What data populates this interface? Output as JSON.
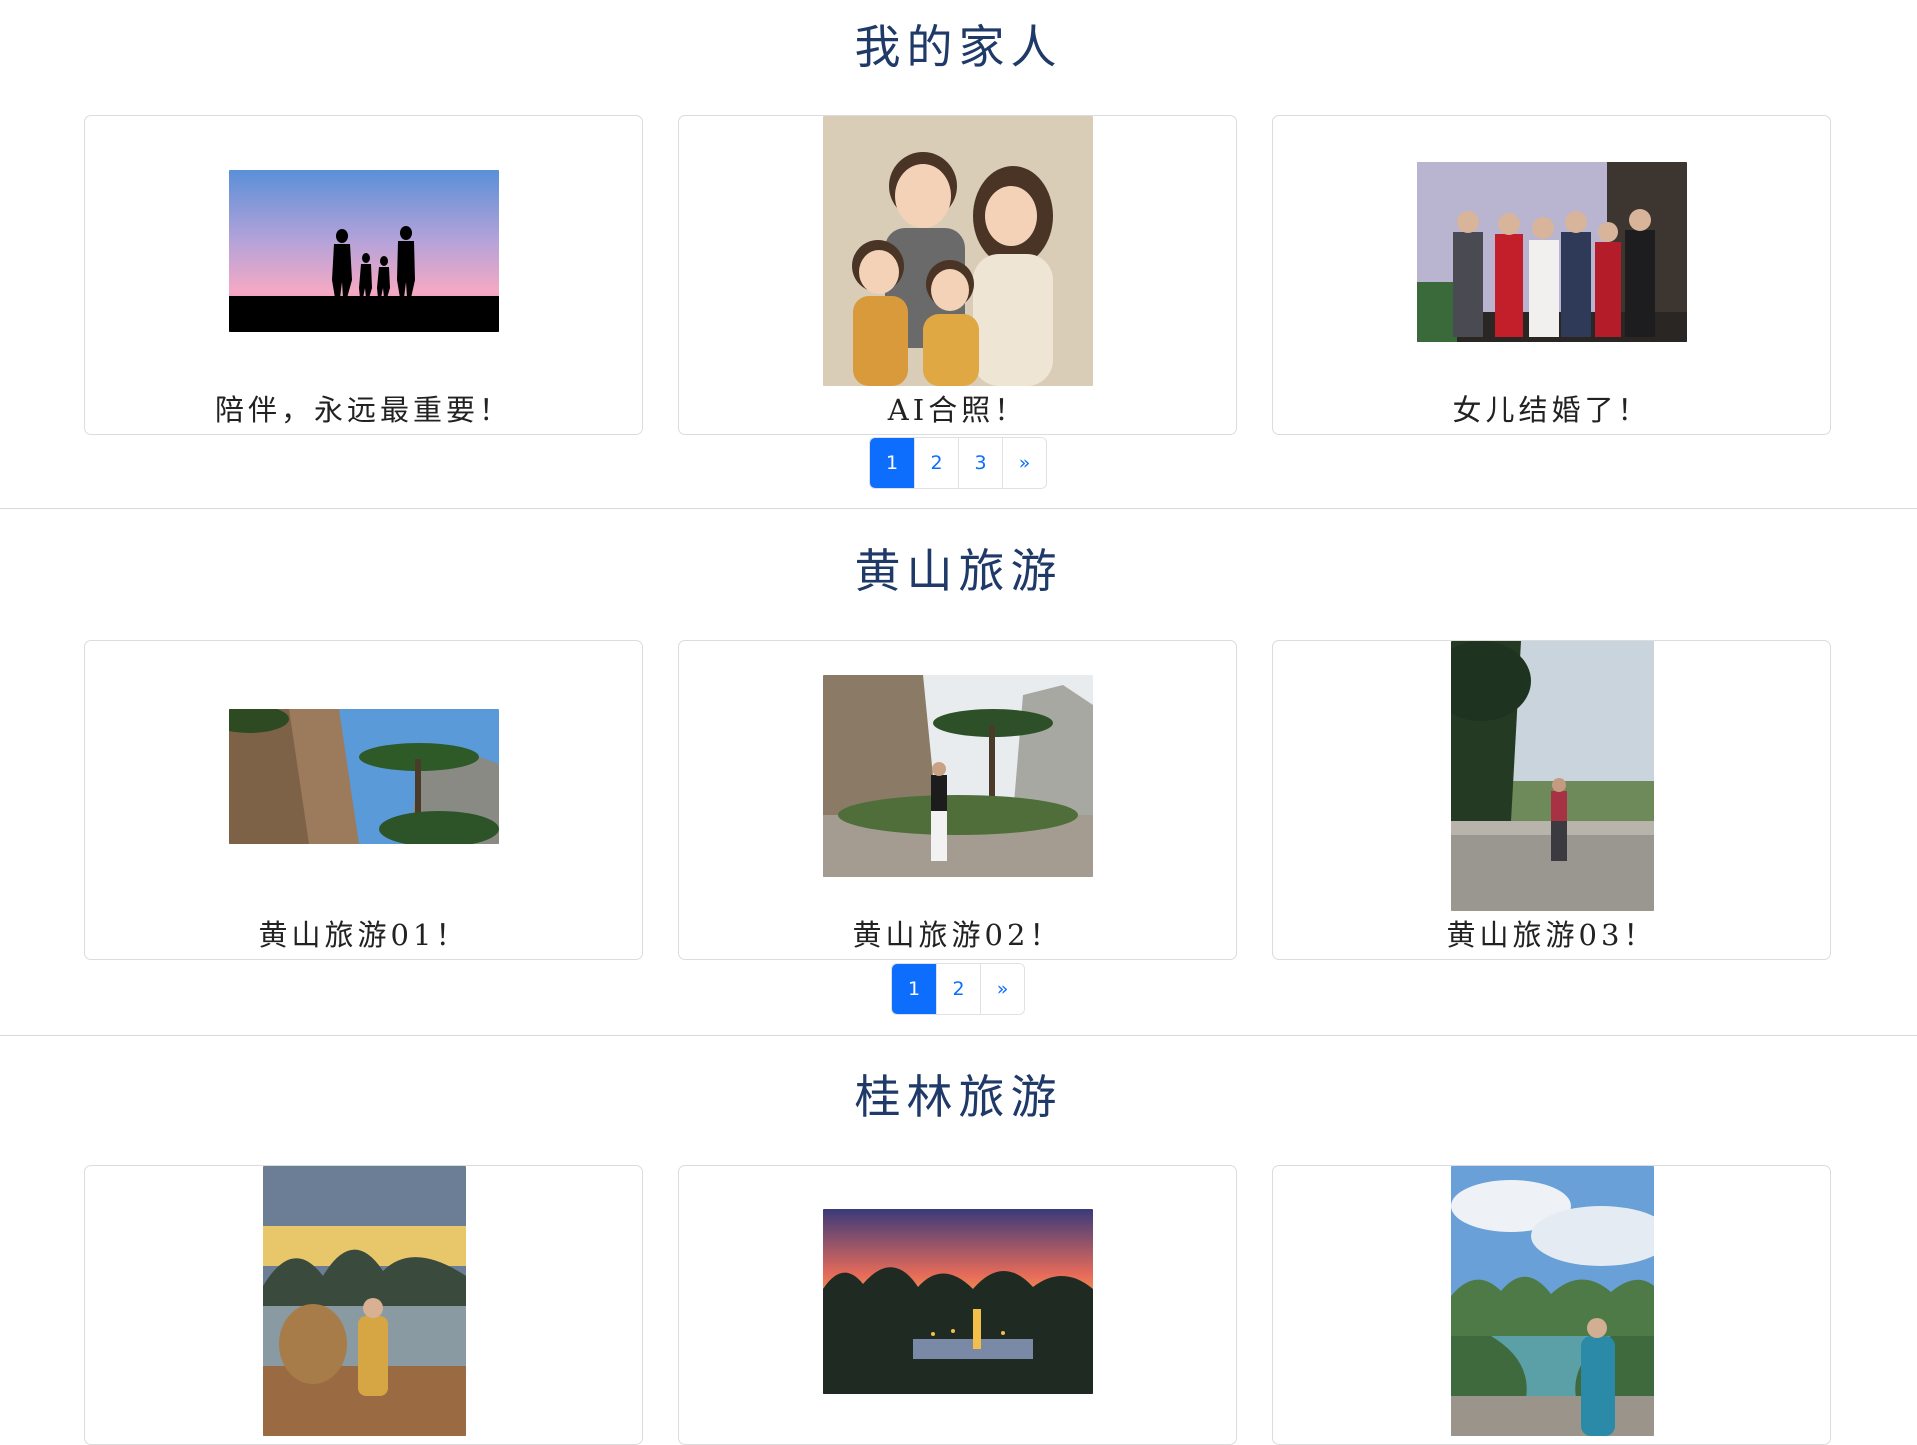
{
  "sections": [
    {
      "title": "我的家人",
      "cards": [
        {
          "caption": "陪伴，永远最重要！",
          "photo_icon": "family-silhouette-sunset"
        },
        {
          "caption": "AI合照！",
          "photo_icon": "cartoon-family-portrait"
        },
        {
          "caption": "女儿结婚了！",
          "photo_icon": "wedding-group-photo"
        }
      ],
      "pages": [
        "1",
        "2",
        "3",
        "»"
      ],
      "active_page": "1"
    },
    {
      "title": "黄山旅游",
      "cards": [
        {
          "caption": "黄山旅游01！",
          "photo_icon": "huangshan-rock-pine"
        },
        {
          "caption": "黄山旅游02！",
          "photo_icon": "huangshan-person-rock"
        },
        {
          "caption": "黄山旅游03！",
          "photo_icon": "huangshan-viewpoint"
        }
      ],
      "pages": [
        "1",
        "2",
        "»"
      ],
      "active_page": "1"
    },
    {
      "title": "桂林旅游",
      "cards": [
        {
          "caption": "",
          "photo_icon": "guilin-raft-sunset"
        },
        {
          "caption": "",
          "photo_icon": "guilin-karst-dusk"
        },
        {
          "caption": "",
          "photo_icon": "guilin-river-view"
        }
      ]
    }
  ],
  "colors": {
    "title": "#1f3a68",
    "accent": "#0d6efd",
    "border": "#dcdcdc"
  }
}
